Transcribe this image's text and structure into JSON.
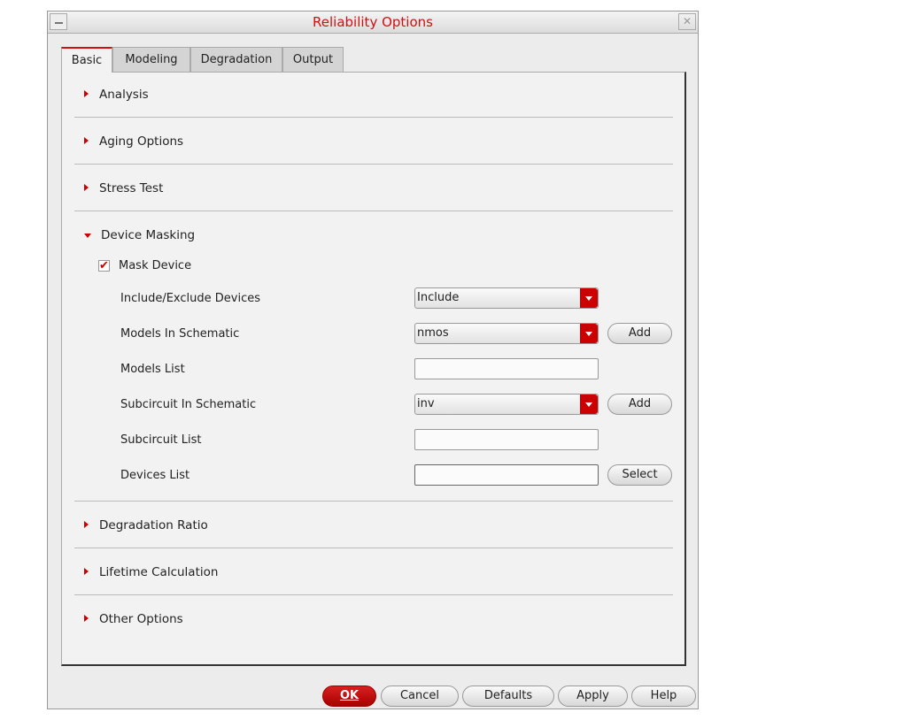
{
  "window": {
    "title": "Reliability Options",
    "close": "✕"
  },
  "tabs": [
    {
      "label": "Basic"
    },
    {
      "label": "Modeling"
    },
    {
      "label": "Degradation"
    },
    {
      "label": "Output"
    }
  ],
  "sections": {
    "analysis": "Analysis",
    "aging": "Aging Options",
    "stress": "Stress Test",
    "masking": "Device Masking",
    "degradation": "Degradation Ratio",
    "lifetime": "Lifetime Calculation",
    "other": "Other Options"
  },
  "masking": {
    "mask_device": {
      "label": "Mask Device",
      "checked": true,
      "mark": "✔"
    },
    "include_exclude": {
      "label": "Include/Exclude Devices",
      "value": "Include"
    },
    "models_in_schematic": {
      "label": "Models In Schematic",
      "value": "nmos",
      "button": "Add"
    },
    "models_list": {
      "label": "Models List",
      "value": ""
    },
    "subcircuit_in_schematic": {
      "label": "Subcircuit In Schematic",
      "value": "inv",
      "button": "Add"
    },
    "subcircuit_list": {
      "label": "Subcircuit List",
      "value": ""
    },
    "devices_list": {
      "label": "Devices List",
      "value": "",
      "button": "Select"
    }
  },
  "footer": {
    "ok": "OK",
    "cancel": "Cancel",
    "defaults": "Defaults",
    "apply": "Apply",
    "help": "Help"
  }
}
